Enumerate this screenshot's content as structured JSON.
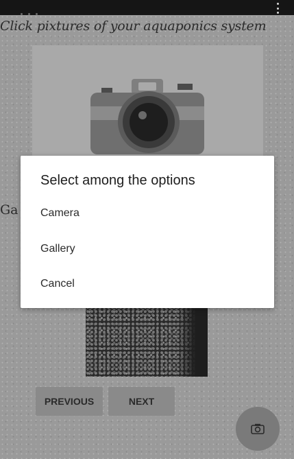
{
  "app": {
    "title": "Click pixtures of your aquaponics system",
    "side_label": "Ga"
  },
  "navigation": {
    "previous_label": "PREVIOUS",
    "next_label": "NEXT"
  },
  "dialog": {
    "title": "Select among the options",
    "options": [
      {
        "label": "Camera"
      },
      {
        "label": "Gallery"
      },
      {
        "label": "Cancel"
      }
    ]
  },
  "icons": {
    "fab": "camera-icon",
    "illustration": "camera-illustration",
    "menu": "overflow-menu-icon"
  },
  "colors": {
    "dim_overlay_background": "#9a9a9a",
    "dialog_background": "#ffffff",
    "fab_background": "#7a7a7a",
    "status_bar": "#151515"
  }
}
